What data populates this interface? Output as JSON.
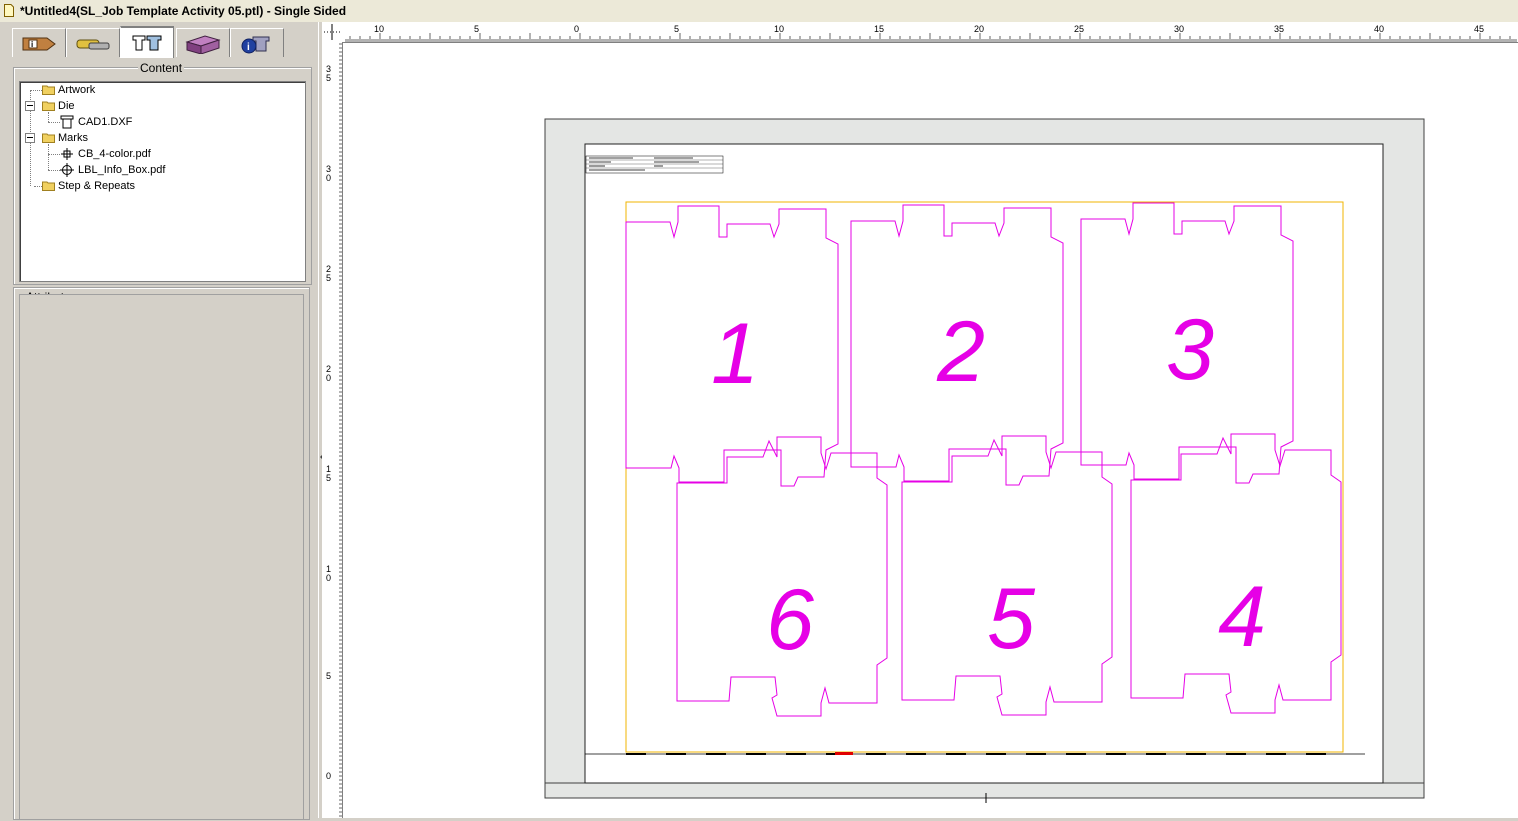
{
  "window": {
    "title": "*Untitled4(SL_Job Template Activity 05.ptl) - Single Sided"
  },
  "tabs": [
    {
      "name": "job-info-tab",
      "icon": "job-info-icon",
      "active": false
    },
    {
      "name": "resources-tab",
      "icon": "resources-icon",
      "active": false
    },
    {
      "name": "content-tab",
      "icon": "content-layout-icon",
      "active": true
    },
    {
      "name": "press-sheet-tab",
      "icon": "press-sheet-icon",
      "active": false
    },
    {
      "name": "info-tab",
      "icon": "info-icon",
      "active": false
    }
  ],
  "content_panel": {
    "title": "Content",
    "tree": [
      {
        "label": "Artwork",
        "icon": "folder-icon",
        "level": 0
      },
      {
        "label": "Die",
        "icon": "folder-icon",
        "level": 0,
        "expanded": true
      },
      {
        "label": "CAD1.DXF",
        "icon": "die-file-icon",
        "level": 1
      },
      {
        "label": "Marks",
        "icon": "folder-icon",
        "level": 0,
        "expanded": true
      },
      {
        "label": "CB_4-color.pdf",
        "icon": "color-bar-mark-icon",
        "level": 1
      },
      {
        "label": "LBL_Info_Box.pdf",
        "icon": "registration-mark-icon",
        "level": 1
      },
      {
        "label": "Step & Repeats",
        "icon": "folder-icon",
        "level": 0
      }
    ]
  },
  "attributes_panel": {
    "title": "Attributes"
  },
  "rulers": {
    "top_labels": [
      "10",
      "5",
      "0",
      "5",
      "10",
      "15",
      "20",
      "25",
      "30",
      "35",
      "40",
      "45"
    ],
    "left_labels": [
      "35",
      "30",
      "25",
      "20",
      "15",
      "10",
      "5",
      "0"
    ]
  },
  "layout": {
    "die_numbers": [
      "1",
      "2",
      "3",
      "6",
      "5",
      "4"
    ]
  },
  "colors": {
    "die_line": "#e600e6",
    "trim_box": "#f0b400",
    "sheet_border": "#e6e6e6"
  }
}
